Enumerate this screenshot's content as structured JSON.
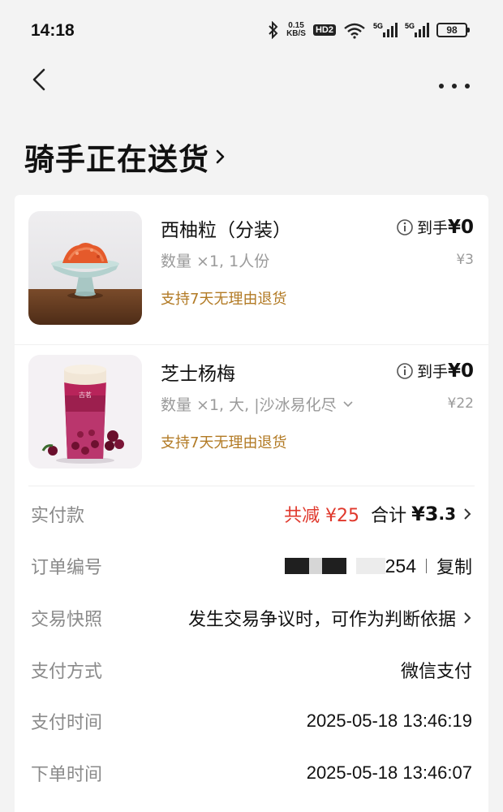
{
  "status_bar": {
    "time": "14:18",
    "net_speed_value": "0.15",
    "net_speed_unit": "KB/S",
    "hd_label": "HD",
    "hd_sub": "2",
    "signal_1_label": "5G",
    "signal_2_label": "5G",
    "battery": "98",
    "icons": [
      "bluetooth-icon",
      "wifi-icon",
      "signal-icon",
      "battery-icon"
    ]
  },
  "nav": {
    "back_icon": "chevron-left-icon",
    "more_icon": "more-horizontal-icon"
  },
  "page": {
    "title": "骑手正在送货"
  },
  "products": [
    {
      "name": "西柚粒（分装）",
      "spec": "数量 ×1, 1人份",
      "return_policy": "支持7天无理由退货",
      "final_label": "到手",
      "final_price": "¥0",
      "original_price": "¥3"
    },
    {
      "name": "芝士杨梅",
      "spec": "数量 ×1, 大, |沙冰易化尽",
      "return_policy": "支持7天无理由退货",
      "final_label": "到手",
      "final_price": "¥0",
      "original_price": "¥22"
    }
  ],
  "order": {
    "paid_label": "实付款",
    "discount_text": "共减 ¥25",
    "total_label": "合计",
    "total_int": "¥3",
    "total_dec": ".3",
    "order_no_label": "订单编号",
    "order_no_suffix": "254",
    "copy_label": "复制",
    "snapshot_label": "交易快照",
    "snapshot_value": "发生交易争议时，可作为判断依据",
    "pay_method_label": "支付方式",
    "pay_method_value": "微信支付",
    "pay_time_label": "支付时间",
    "pay_time_value": "2025-05-18 13:46:19",
    "order_time_label": "下单时间",
    "order_time_value": "2025-05-18 13:46:07"
  },
  "colors": {
    "background": "#f3f3f3",
    "card": "#ffffff",
    "discount_red": "#e0382c",
    "return_policy_gold": "#b27a24",
    "muted_gray": "#8a8a8a"
  }
}
